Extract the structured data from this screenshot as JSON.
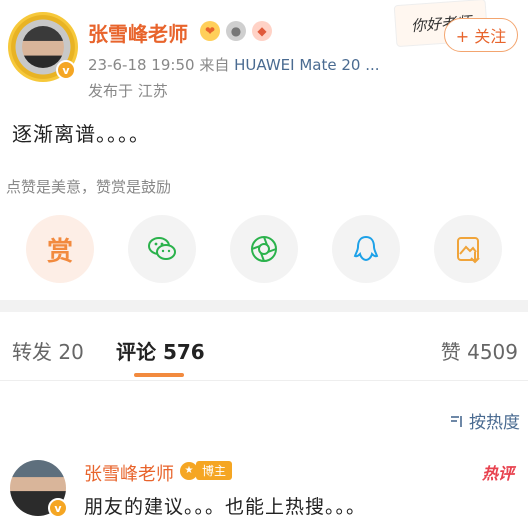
{
  "post": {
    "author": "张雪峰老师",
    "meta_time": "23-6-18 19:50",
    "meta_from": "来自",
    "meta_device": "HUAWEI Mate 20 ...",
    "location": "发布于 江苏",
    "sticker_text": "你好老师",
    "follow_label": "+ 关注",
    "text": "逐渐离谱。。。。",
    "tip": "点赞是美意，赞赏是鼓励",
    "reward_label": "赏",
    "badge_icons": [
      "heart-icon",
      "medal-icon",
      "fish-icon"
    ],
    "verified_mark": "v"
  },
  "share": {
    "items": [
      "reward",
      "wechat-icon",
      "moments-icon",
      "qq-icon",
      "save-image-icon"
    ]
  },
  "tabs": {
    "repost_label": "转发 20",
    "comment_label": "评论 576",
    "like_label": "赞 4509"
  },
  "sort": {
    "label": "按热度"
  },
  "comment": {
    "author": "张雪峰老师",
    "tag": "博主",
    "hot": "热评",
    "text": "朋友的建议。。。也能上热搜。。。",
    "verified_mark": "v"
  },
  "colors": {
    "accent": "#e8642c",
    "link": "#4a6b91",
    "hot": "#e8424f",
    "reward": "#f28a3e"
  }
}
